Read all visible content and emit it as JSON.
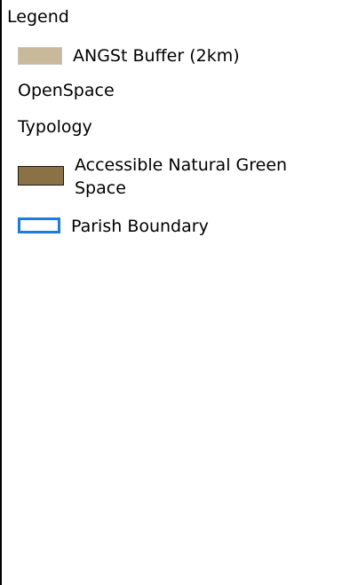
{
  "legend": {
    "title": "Legend",
    "items": [
      {
        "type": "layer",
        "label": "ANGSt Buffer (2km)",
        "swatch": "fill",
        "color": "#c9b99b",
        "border": "#c7c7c7"
      },
      {
        "type": "group",
        "label": "OpenSpace"
      },
      {
        "type": "group",
        "label": "Typology"
      },
      {
        "type": "layer",
        "label": "Accessible Natural Green Space",
        "swatch": "fill",
        "color": "#8b7246",
        "border": "#1a1a1a"
      },
      {
        "type": "layer",
        "label": "Parish Boundary",
        "swatch": "outline",
        "color": "#1e7bd9"
      }
    ]
  }
}
